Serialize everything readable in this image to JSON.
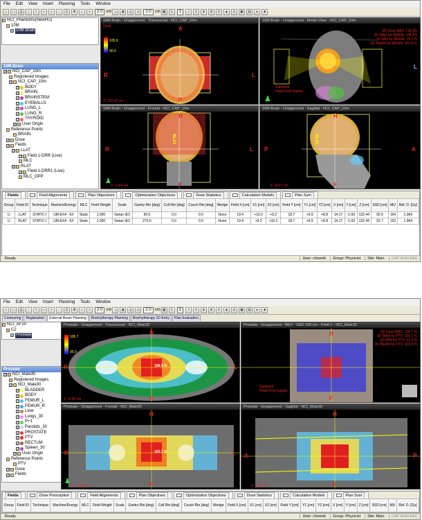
{
  "menu": [
    "File",
    "Edit",
    "View",
    "Insert",
    "Planning",
    "Tools",
    "Window"
  ],
  "toolbar": {
    "zoom": "2.0",
    "unit": "cm",
    "zoom2": "2.0",
    "num": "1"
  },
  "w1": {
    "top_tree": {
      "root": "NCI_Phantoms(NewHU)",
      "study": "10M",
      "image": "10M Brain"
    },
    "panel_head": "10M Brain",
    "tree": {
      "plan": "NCI_CAP_10m",
      "reg": "Registered Images",
      "set": "NCI_CAP_10m",
      "structures": [
        {
          "name": "BODY",
          "c": "#ffc000"
        },
        {
          "name": "BRAIN",
          "c": "#ffe36e"
        },
        {
          "name": "BRAINSTEM",
          "c": "#b040b0"
        },
        {
          "name": "EYEBALLS",
          "c": "#30d0ff"
        },
        {
          "name": "LUNG_L",
          "c": "#d040d0"
        },
        {
          "name": "LUNG_R",
          "c": "#60c030"
        },
        {
          "name": "THYROID",
          "c": "#ff6060"
        }
      ],
      "origin": "User Origin",
      "ref": "Reference Points",
      "refpt": "BRAIN",
      "dose": "Dose",
      "fields": "Fields",
      "f1": "LLAT",
      "f1a": "Field 1-DRR (Live)",
      "f1b": "MLC",
      "f2": "RLAT",
      "f2a": "Field 1-DRR1 (Live)",
      "f2b": "MLC_OPP"
    },
    "views": {
      "trans": {
        "title": "10M Brain - Unapproved - Transversal - NCI_CAP_10m",
        "A": "A",
        "P": "P",
        "L": "L",
        "R": "R",
        "info": "Z: 132.37 cm",
        "dose": "Dose",
        "d1": "105.9",
        "d2": "90.0"
      },
      "model": {
        "title": "10M Brain - Unapproved - Model View - NCI_CAP_10m",
        "l1": "3D Dose MAX: 116.3%",
        "l2": "3D MAX for BRAIN: 108.3%",
        "l3": "3D MIN for BRAIN: 79.1 %",
        "l4": "3D MEAN for BRAIN: 102.5 %",
        "orient": "Standard\nHead First-Supine",
        "L": "L"
      },
      "front": {
        "title": "10M Brain - Unapproved - Frontal - NCI_CAP_10m",
        "H": "H",
        "F": "F",
        "L": "L",
        "R": "R",
        "info": "Y: -1.69 cm",
        "lbl": "RLAT"
      },
      "sag": {
        "title": "10M Brain - Unapproved - Sagittal - NCI_CAP_10m",
        "H": "H",
        "F": "F",
        "A": "A",
        "P": "P",
        "info": "X: 14.17 cm",
        "lbl": "RLAT"
      }
    },
    "tabs": [
      "Fields",
      "Field Alignments",
      "Plan Objectives",
      "Optimization Objectives",
      "Dose Statistics",
      "Calculation Models",
      "Plan Sum"
    ],
    "headers": [
      "Group",
      "Field ID",
      "Technique",
      "Machine/Energy",
      "MLC",
      "Field Weight",
      "Scale",
      "Gantry Rtn [deg]",
      "Coll Rtn [deg]",
      "Couch Rtn [deg]",
      "Wedge",
      "Field X [cm]",
      "X1 [cm]",
      "X2 [cm]",
      "Field Y [cm]",
      "Y1 [cm]",
      "Y2 [cm]",
      "X [cm]",
      "Y [cm]",
      "Z [cm]",
      "SSD [cm]",
      "MU",
      "Ref. D. [Gy]"
    ],
    "rows": [
      [
        "☑",
        "LLAT",
        "STATIC-I",
        "UM-EX4 - 6X",
        "Static",
        "1.000",
        "Varian IEC",
        "90.0",
        "0.0",
        "0.0",
        "None",
        "19.4",
        "+10.2",
        "+9.2",
        "18.7",
        "+9.9",
        "+8.8",
        "14.17",
        "-1.69",
        "132.44",
        "92.6",
        "164",
        "1.964"
      ],
      [
        "☑",
        "RLAT",
        "STATIC-I",
        "UM-EX4 - 6X",
        "Static",
        "1.000",
        "Varian IEC",
        "270.0",
        "0.0",
        "0.0",
        "None",
        "19.4",
        "+9.2",
        "+10.2",
        "18.7",
        "+9.9",
        "+8.8",
        "14.17",
        "-1.69",
        "132.44",
        "92.7",
        "163",
        "1.964"
      ]
    ],
    "status": {
      "ready": "Ready",
      "user": "User: choonik",
      "group": "Group: Physicist",
      "site": "Site: Main",
      "caps": "CAP NUM REC"
    }
  },
  "w2": {
    "workspace_tabs": [
      "Contouring",
      "Registration",
      "External Beam Planning",
      "Brachytherapy Planning",
      "Brachytherapy 2D Entry",
      "Plan Evaluation"
    ],
    "top_tree": {
      "root": "NCI_AF20",
      "study": "C2",
      "image": "Prostate"
    },
    "panel_head": "Prostate",
    "tree": {
      "plan": "NCI_Male30",
      "reg": "Registered Images",
      "set": "NCI_Male30",
      "structures": [
        {
          "name": "BLADDER",
          "c": "#ffff40"
        },
        {
          "name": "BODY",
          "c": "#ffc000"
        },
        {
          "name": "FEMUR_L",
          "c": "#40c0ff"
        },
        {
          "name": "FEMUR_R",
          "c": "#40a0ff"
        },
        {
          "name": "Liver",
          "c": "#c08040"
        },
        {
          "name": "Lungs_30",
          "c": "#ff80ff"
        },
        {
          "name": "P+1",
          "c": "#60d060"
        },
        {
          "name": "Parotids_30",
          "c": "#d0d0ff"
        },
        {
          "name": "PROSTATE",
          "c": "#ff3030"
        },
        {
          "name": "PTV",
          "c": "#ff2020"
        },
        {
          "name": "RECTUM",
          "c": "#a06030"
        },
        {
          "name": "Spleen_30",
          "c": "#c040c0"
        }
      ],
      "origin": "User Origin",
      "ref": "Reference Points",
      "refpt": "PTV",
      "dose": "Dose",
      "fields": "Fields"
    },
    "views": {
      "trans": {
        "title": "Prostate - Unapproved - Transversal - NCI_Male30",
        "A": "A",
        "P": "P",
        "R": "R",
        "L": "L",
        "info": "Z: -0.00 cm",
        "d1": "106.7",
        "d2": "95.0",
        "dot": "100.0 %"
      },
      "bev": {
        "title": "Prostate - Unapproved - BEV - SAD 100 cm - Field 1 - NCI_Male30",
        "l1": "3D Dose MAX: 106.7 %",
        "l2": "3D MAX for PTV: 106.7 %",
        "l3": "3D MIN for PTV: 91.0 %",
        "l4": "3D MEAN for PTV: 104.3 %",
        "orient": "Standard\nHead First-Supine",
        "H": "H",
        "F": "F"
      },
      "front": {
        "title": "Prostate - Unapproved - Frontal - NCI_Male30",
        "H": "H",
        "F": "F",
        "R": "R",
        "L": "L",
        "info": "Y: -3.08 cm",
        "dot": "103.1 %"
      },
      "sag": {
        "title": "Prostate - Unapproved - Sagittal - NCI_Male30",
        "H": "H",
        "F": "F",
        "A": "A",
        "P": "P",
        "info": "X: 0.00 cm"
      }
    },
    "tabs": [
      "Fields",
      "Dose Prescription",
      "Field Alignments",
      "Plan Objectives",
      "Optimization Objectives",
      "Dose Statistics",
      "Calculation Models",
      "Plan Sum"
    ],
    "headers": [
      "Group",
      "Field ID",
      "Technique",
      "Machine/Energy",
      "MLC",
      "Field Weight",
      "Scale",
      "Gantry Rtn [deg]",
      "Coll Rtn [deg]",
      "Couch Rtn [deg]",
      "Wedge",
      "Field X [cm]",
      "X1 [cm]",
      "X2 [cm]",
      "Field Y [cm]",
      "Y1 [cm]",
      "Y2 [cm]",
      "X [cm]",
      "Y [cm]",
      "Z [cm]",
      "SSD [cm]",
      "MU",
      "Ref. D. [Gy]"
    ],
    "status": {
      "ready": "Ready",
      "user": "User: choonik",
      "group": "Group: Physicist",
      "site": "Site: Main",
      "caps": "CAP NUM REC"
    }
  }
}
